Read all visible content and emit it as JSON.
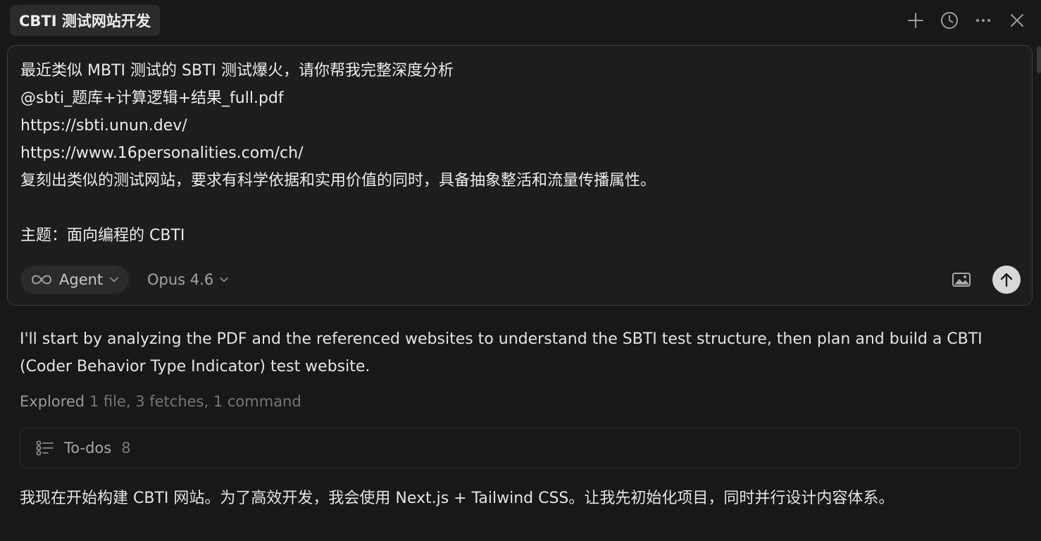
{
  "window": {
    "tab_title": "CBTI 测试网站开发",
    "actions": [
      {
        "icon": "plus-icon"
      },
      {
        "icon": "history-icon"
      },
      {
        "icon": "more-icon"
      },
      {
        "icon": "close-icon"
      }
    ]
  },
  "composer": {
    "lines": [
      "最近类似 MBTI 测试的 SBTI 测试爆火，请你帮我完整深度分析",
      "@sbti_题库+计算逻辑+结果_full.pdf",
      "https://sbti.unun.dev/",
      "https://www.16personalities.com/ch/",
      "复刻出类似的测试网站，要求有科学依据和实用价值的同时，具备抽象整活和流量传播属性。",
      "",
      "主题：面向编程的 CBTI"
    ],
    "mode_label": "Agent",
    "model_label": "Opus 4.6"
  },
  "conversation": {
    "intro": "I'll start by analyzing the PDF and the referenced websites to understand the SBTI test structure, then plan and build a CBTI (Coder Behavior Type Indicator) test website.",
    "explored_verb": "Explored",
    "explored_detail": "1 file, 3 fetches, 1 command",
    "todos_label": "To-dos",
    "todos_count": "8",
    "followup": "我现在开始构建 CBTI 网站。为了高效开发，我会使用 Next.js + Tailwind CSS。让我先初始化项目，同时并行设计内容体系。"
  },
  "colors": {
    "background": "#181818",
    "composer_bg": "#1d1d1d",
    "pill_bg": "#2b2b2b",
    "send_button": "#d8d8d8"
  }
}
